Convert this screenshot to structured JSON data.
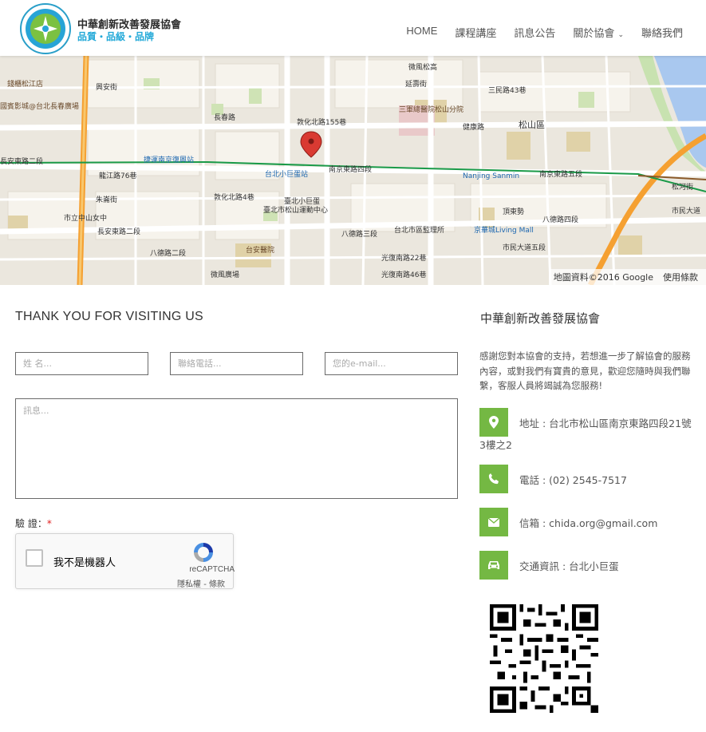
{
  "header": {
    "logo_title": "中華創新改善發展協會",
    "logo_sub": "品質・品級・品牌",
    "nav": [
      {
        "label": "HOME"
      },
      {
        "label": "課程講座"
      },
      {
        "label": "訊息公告"
      },
      {
        "label": "關於協會"
      },
      {
        "label": "聯絡我們"
      }
    ]
  },
  "map": {
    "labels": [
      "錢櫃松江店",
      "興安街",
      "國賓影城@台北長春廣場",
      "長安東路二段",
      "龍江路76巷",
      "朱崙街",
      "市立中山女中",
      "長安東路二段",
      "八德路二段",
      "微風廣場",
      "敦化北路155巷",
      "長春路",
      "三軍總醫院松山分院",
      "微風松高",
      "延壽街",
      "三民路43巷",
      "健康路",
      "松山區",
      "台北小巨蛋站",
      "南京東路四段",
      "Nanjing Sanmin",
      "南京東路五段",
      "臺北小巨蛋",
      "臺北市松山運動中心",
      "八德路三段",
      "光復南路22巷",
      "光復南路46巷",
      "台北市區監理所",
      "京華城Living Mall",
      "八德路四段",
      "市民大道五段",
      "台安醫院",
      "捷運南京復興站",
      "頂東勢",
      "市民大道",
      "敦化北路4巷",
      "松河街"
    ],
    "attribution": "地圖資料©2016 Google",
    "terms": "使用條款"
  },
  "form": {
    "title": "THANK YOU FOR VISITING US",
    "name_placeholder": "姓 名...",
    "phone_placeholder": "聯絡電話...",
    "email_placeholder": "您的e-mail...",
    "message_placeholder": "訊息...",
    "verify_label": "驗 證：",
    "required_mark": "*",
    "captcha_text": "我不是機器人",
    "captcha_brand": "reCAPTCHA",
    "captcha_terms": "隱私權 - 條款"
  },
  "contact": {
    "title": "中華創新改善發展協會",
    "intro": "感謝您對本協會的支持，若想進一步了解協會的服務內容，或對我們有寶貴的意見，歡迎您隨時與我們聯繫，客服人員將竭誠為您服務!",
    "address": "地址 : 台北市松山區南京東路四段21號",
    "address_cont": "3樓之2",
    "phone": "電話 : (02) 2545-7517",
    "email": "信箱 : chida.org@gmail.com",
    "transit": "交通資訊 : 台北小巨蛋"
  },
  "colors": {
    "accent_green": "#74b843",
    "brand_blue": "#23a9d8",
    "marker_red": "#d93a32"
  },
  "icons": [
    "map-marker-icon",
    "phone-icon",
    "envelope-icon",
    "car-icon"
  ]
}
